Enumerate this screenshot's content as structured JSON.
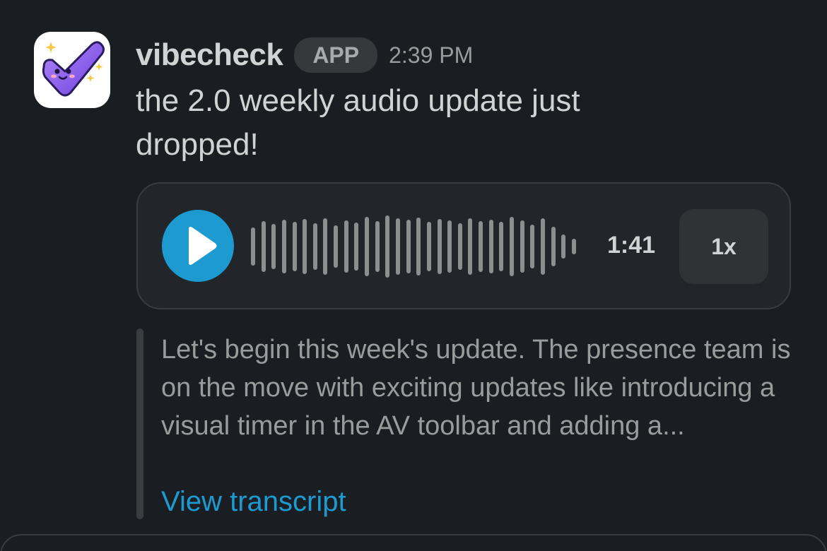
{
  "message": {
    "sender": "vibecheck",
    "badge": "APP",
    "timestamp": "2:39 PM",
    "text": "the 2.0 weekly audio update just dropped!",
    "avatar_icon": "checkmark-mascot-icon"
  },
  "audio_player": {
    "play_icon": "play-icon",
    "duration": "1:41",
    "speed": "1x",
    "accent_color": "#1d9bd1"
  },
  "transcript": {
    "excerpt": "Let's begin this week's update. The presence team is on the move with exciting updates like introducing a visual timer in the AV toolbar and adding a...",
    "link_label": "View transcript"
  },
  "colors": {
    "background": "#1a1d21",
    "link": "#1d9bd1",
    "text_primary": "#d1d2d3",
    "text_muted": "#9a9b9d"
  }
}
